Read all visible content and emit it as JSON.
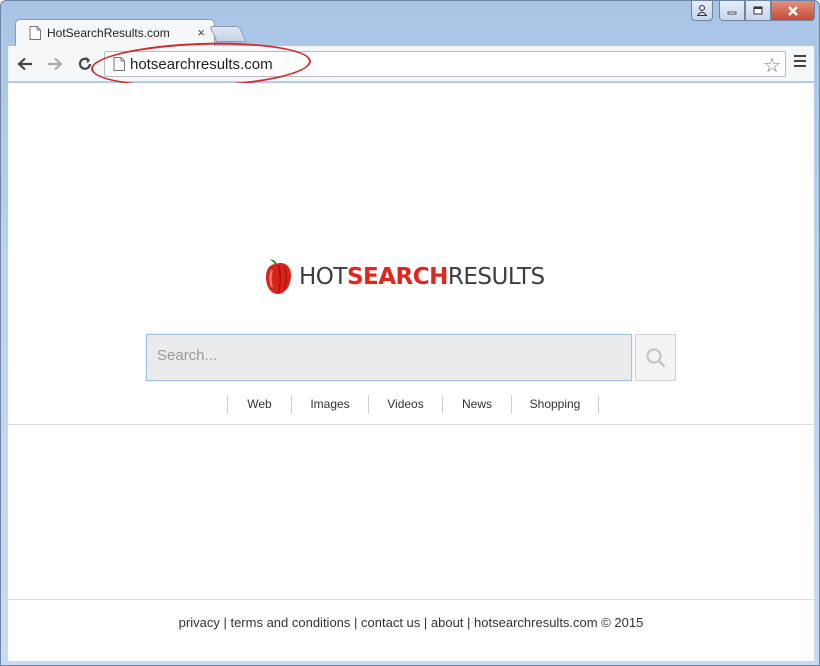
{
  "browser": {
    "tab_title": "HotSearchResults.com",
    "tab_close": "×",
    "url": "hotsearchresults.com",
    "nav": {
      "back": "back-arrow",
      "forward": "forward-arrow",
      "reload": "reload"
    }
  },
  "window_controls": {
    "user": "user-icon",
    "minimize": "minimize",
    "maximize": "maximize",
    "close": "close"
  },
  "logo": {
    "part1": "HOT",
    "part2": "SEARCH",
    "part3": "RESULTS",
    "accent": "#e1261c",
    "text_color": "#3d3d3d"
  },
  "search": {
    "placeholder": "Search..."
  },
  "categories": [
    {
      "label": "Web"
    },
    {
      "label": "Images"
    },
    {
      "label": "Videos"
    },
    {
      "label": "News"
    },
    {
      "label": "Shopping"
    }
  ],
  "footer": {
    "privacy": "privacy",
    "terms": "terms and conditions",
    "contact": "contact us",
    "about": "about",
    "copyright": "hotsearchresults.com © 2015",
    "sep": " | "
  }
}
